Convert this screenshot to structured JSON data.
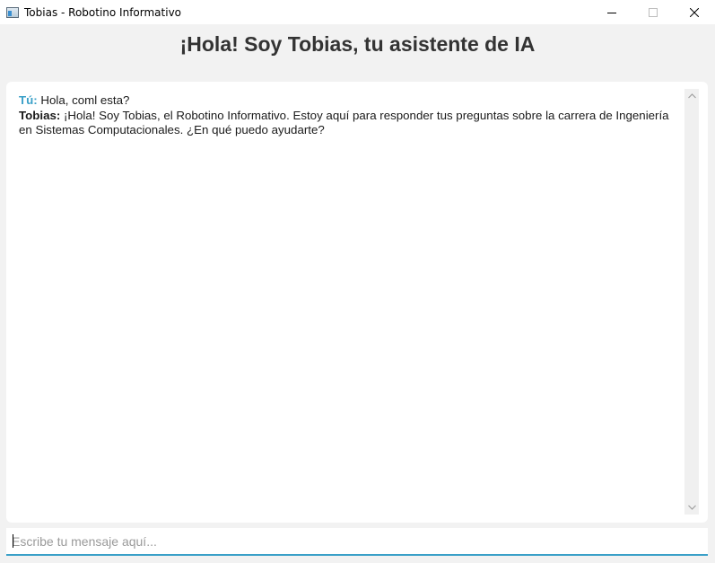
{
  "window": {
    "title": "Tobias - Robotino Informativo",
    "icon": "app-window-icon",
    "controls": [
      "minimize-icon",
      "maximize-icon",
      "close-icon"
    ]
  },
  "header": {
    "title": "¡Hola! Soy Tobias, tu asistente de IA"
  },
  "chat": {
    "messages": [
      {
        "sender": "Tú:",
        "text": " Hola, coml esta?"
      },
      {
        "sender": "Tobias:",
        "text": " ¡Hola! Soy Tobias, el Robotino Informativo. Estoy aquí para responder tus preguntas sobre la carrera de Ingeniería en Sistemas Computacionales. ¿En qué puedo ayudarte?"
      }
    ]
  },
  "input": {
    "value": "",
    "placeholder": "Escribe tu mensaje aquí..."
  },
  "colors": {
    "accent": "#3aa0c8",
    "header_text": "#333333",
    "background": "#f2f2f2"
  }
}
